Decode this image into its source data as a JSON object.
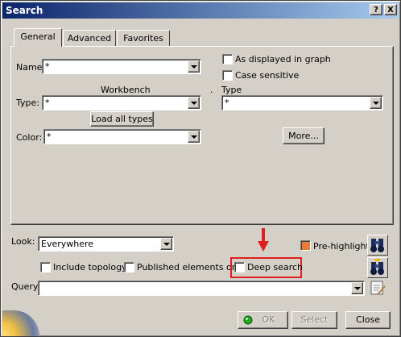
{
  "window": {
    "title": "Search",
    "help_button": "?",
    "close_button": "X"
  },
  "tabs": [
    {
      "label": "General",
      "active": true
    },
    {
      "label": "Advanced",
      "active": false
    },
    {
      "label": "Favorites",
      "active": false
    }
  ],
  "general": {
    "name_label": "Name:",
    "name_value": "*",
    "workbench_label": "Workbench",
    "type_label": "Type:",
    "type_value": "*",
    "load_all_types": "Load all types",
    "color_label": "Color:",
    "color_value": "*",
    "as_displayed": "As displayed in graph",
    "case_sensitive": "Case sensitive",
    "separator_dot": ".",
    "type_header": "Type",
    "type_right_value": "*",
    "more_button": "More..."
  },
  "bottom": {
    "look_label": "Look:",
    "look_value": "Everywhere",
    "pre_highlight": "Pre-highlight",
    "include_topology": "Include topology",
    "published_only": "Published elements only",
    "deep_search": "Deep search",
    "query_label": "Query:",
    "query_value": ""
  },
  "actions": {
    "ok": "OK",
    "select": "Select",
    "close": "Close"
  },
  "colors": {
    "highlight": "#e02020",
    "ok_indicator": "#22aa22",
    "prehighlight_check": "#e87a3a"
  },
  "icons": [
    "search-binoculars-icon",
    "search-add-binoculars-icon",
    "query-edit-icon",
    "ok-green-dot-icon"
  ]
}
